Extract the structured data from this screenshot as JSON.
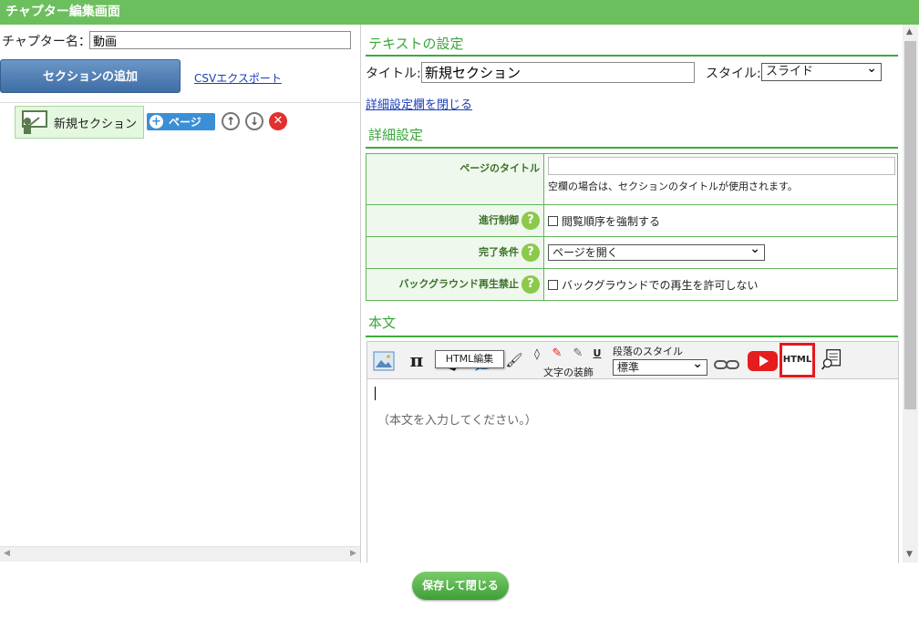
{
  "window": {
    "title": "チャプター編集画面"
  },
  "left": {
    "chapter_label": "チャプター名：",
    "chapter_value": "動画",
    "add_section_label": "セクションの追加",
    "csv_export_label": "CSVエクスポート",
    "sections": [
      {
        "label": "新規セクション",
        "page_button_label": "ページ"
      }
    ]
  },
  "right": {
    "text_settings_heading": "テキストの設定",
    "title_label": "タイトル:",
    "title_value": "新規セクション",
    "style_label": "スタイル:",
    "style_value": "スライド",
    "close_details_label": "詳細設定欄を閉じる",
    "details_heading": "詳細設定",
    "details": {
      "page_title_label": "ページのタイトル",
      "page_title_hint": "空欄の場合は、セクションのタイトルが使用されます。",
      "progress_label": "進行制御",
      "progress_checkbox": "閲覧順序を強制する",
      "completion_label": "完了条件",
      "completion_value": "ページを開く",
      "bg_label": "バックグラウンド再生禁止",
      "bg_checkbox": "バックグラウンドでの再生を許可しない"
    },
    "body_heading": "本文",
    "toolbar": {
      "pi_symbol": "π",
      "underline_symbol": "U",
      "text_deco_caption": "文字の装飾",
      "para_style_caption": "段落のスタイル",
      "para_style_value": "標準",
      "html_button_label": "HTML",
      "html_tooltip": "HTML編集"
    },
    "editor_placeholder": "（本文を入力してください。）"
  },
  "footer": {
    "save_close_label": "保存して閉じる"
  }
}
